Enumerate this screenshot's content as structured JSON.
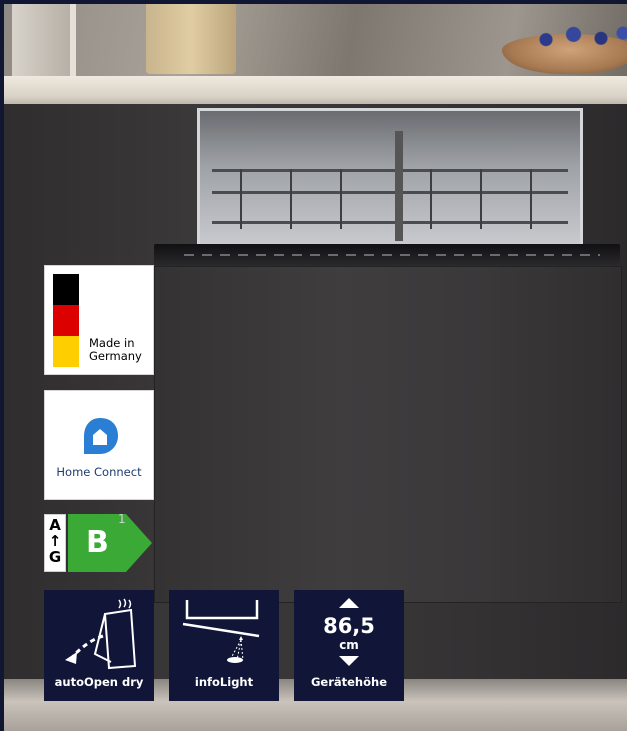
{
  "labels": {
    "made_in": "Made in",
    "germany": "Germany",
    "home_connect": "Home Connect"
  },
  "energy": {
    "scale_top": "A",
    "scale_arrow": "↑",
    "scale_bottom": "G",
    "class": "B",
    "footnote": "1",
    "class_color": "#3aa935"
  },
  "features": [
    {
      "label": "autoOpen dry",
      "icon": "auto-open-dry-icon"
    },
    {
      "label": "infoLight",
      "icon": "info-light-icon"
    },
    {
      "label": "Gerätehöhe",
      "icon": "height-arrows-icon",
      "value": "86,5",
      "unit": "cm"
    }
  ],
  "colors": {
    "badge_bg": "#111639",
    "flag_black": "#000000",
    "flag_red": "#dd0000",
    "flag_gold": "#ffce00",
    "home_connect_blue": "#2a7fd4"
  }
}
